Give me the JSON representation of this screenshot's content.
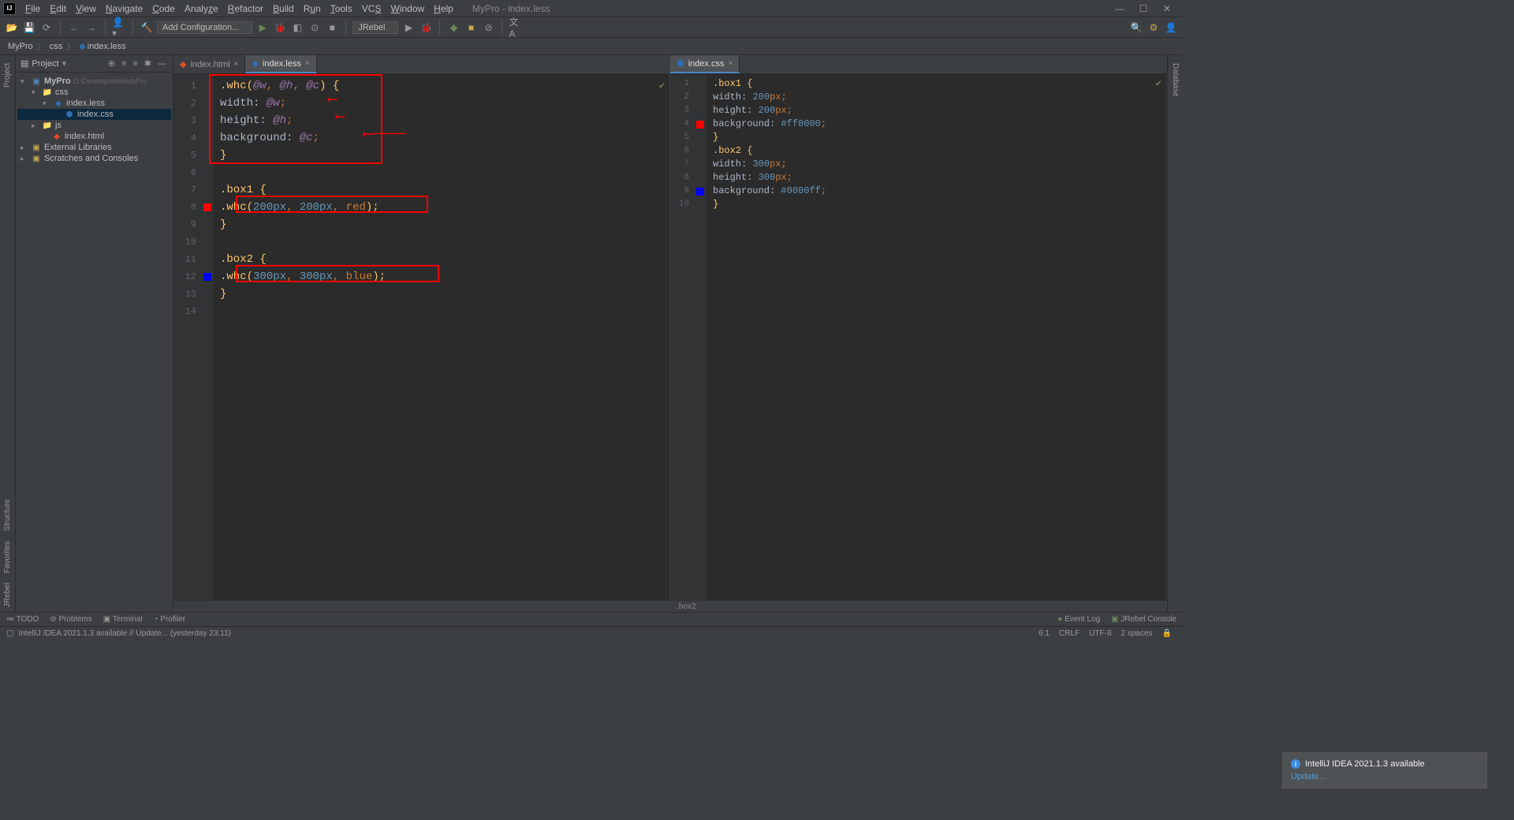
{
  "window_title": "MyPro - index.less",
  "menu": [
    "File",
    "Edit",
    "View",
    "Navigate",
    "Code",
    "Analyze",
    "Refactor",
    "Build",
    "Run",
    "Tools",
    "VCS",
    "Window",
    "Help"
  ],
  "toolbar": {
    "config_label": "Add Configuration...",
    "jrebel_label": "JRebel"
  },
  "breadcrumbs": [
    "MyPro",
    "css",
    "index.less"
  ],
  "editor_breadcrumb": ".box2",
  "project_panel": {
    "title": "Project",
    "root": "MyPro",
    "root_path": "D:\\Develop\\Web\\MyPro",
    "css_folder": "css",
    "less_file": "index.less",
    "css_file": "index.css",
    "js_folder": "js",
    "html_file": "index.html",
    "external_libs": "External Libraries",
    "scratches": "Scratches and Consoles"
  },
  "left_tabs": {
    "index_html": "index.html",
    "index_less": "index.less"
  },
  "right_tabs": {
    "index_css": "index.css"
  },
  "left_code": {
    "l1_a": ".whc(",
    "l1_b": "@w",
    "l1_c": ", ",
    "l1_d": "@h",
    "l1_e": ", ",
    "l1_f": "@c",
    "l1_g": ") {",
    "l2_a": "    width: ",
    "l2_b": "@w",
    "l2_c": ";",
    "l3_a": "    height: ",
    "l3_b": "@h",
    "l3_c": ";",
    "l4_a": "    background: ",
    "l4_b": "@c",
    "l4_c": ";",
    "l5": "}",
    "l7_a": ".box1",
    "l7_b": " {",
    "l8_a": "    .whc(",
    "l8_b": "200px",
    "l8_c": ", ",
    "l8_d": "200px",
    "l8_e": ", ",
    "l8_f": "red",
    "l8_g": ");",
    "l9": "}",
    "l11_a": ".box2",
    "l11_b": " {",
    "l12_a": "    .whc(",
    "l12_b": "300px",
    "l12_c": ", ",
    "l12_d": "300px",
    "l12_e": ", ",
    "l12_f": "blue",
    "l12_g": ");",
    "l13": "}"
  },
  "left_line_numbers": [
    "1",
    "2",
    "3",
    "4",
    "5",
    "6",
    "7",
    "8",
    "9",
    "10",
    "11",
    "12",
    "13",
    "14"
  ],
  "right_code": {
    "l1_a": ".box1",
    "l1_b": " {",
    "l2_a": "  width: ",
    "l2_b": "200",
    "l2_c": "px",
    "l2_d": ";",
    "l3_a": "  height: ",
    "l3_b": "200",
    "l3_c": "px",
    "l3_d": ";",
    "l4_a": "  background: ",
    "l4_b": "#ff0000",
    "l4_c": ";",
    "l5": "}",
    "l6_a": ".box2",
    "l6_b": " {",
    "l7_a": "  width: ",
    "l7_b": "300",
    "l7_c": "px",
    "l7_d": ";",
    "l8_a": "  height: ",
    "l8_b": "300",
    "l8_c": "px",
    "l8_d": ";",
    "l9_a": "  background: ",
    "l9_b": "#0000ff",
    "l9_c": ";",
    "l10": "}"
  },
  "right_line_numbers": [
    "1",
    "2",
    "3",
    "4",
    "5",
    "6",
    "7",
    "8",
    "9",
    "10"
  ],
  "left_tools": [
    "Project",
    "Structure",
    "Favorites",
    "JRebel"
  ],
  "right_tools": [
    "Database"
  ],
  "bottom_tools": {
    "todo": "TODO",
    "problems": "Problems",
    "terminal": "Terminal",
    "profiler": "Profiler",
    "eventlog": "Event Log",
    "jrebel_console": "JRebel Console"
  },
  "status": {
    "msg": "IntelliJ IDEA 2021.1.3 available // Update... (yesterday 23:11)",
    "cursor": "6:1",
    "crlf": "CRLF",
    "encoding": "UTF-8",
    "indent": "2 spaces"
  },
  "notification": {
    "title": "IntelliJ IDEA 2021.1.3 available",
    "link": "Update..."
  },
  "colors": {
    "red": "#ff0000",
    "blue": "#0000ff"
  }
}
